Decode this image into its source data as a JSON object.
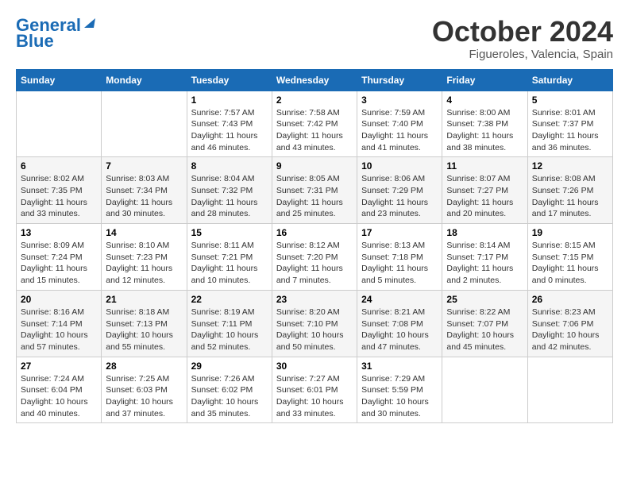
{
  "header": {
    "logo_line1": "General",
    "logo_line2": "Blue",
    "month_title": "October 2024",
    "subtitle": "Figueroles, Valencia, Spain"
  },
  "weekdays": [
    "Sunday",
    "Monday",
    "Tuesday",
    "Wednesday",
    "Thursday",
    "Friday",
    "Saturday"
  ],
  "weeks": [
    [
      {
        "day": "",
        "info": ""
      },
      {
        "day": "",
        "info": ""
      },
      {
        "day": "1",
        "info": "Sunrise: 7:57 AM\nSunset: 7:43 PM\nDaylight: 11 hours and 46 minutes."
      },
      {
        "day": "2",
        "info": "Sunrise: 7:58 AM\nSunset: 7:42 PM\nDaylight: 11 hours and 43 minutes."
      },
      {
        "day": "3",
        "info": "Sunrise: 7:59 AM\nSunset: 7:40 PM\nDaylight: 11 hours and 41 minutes."
      },
      {
        "day": "4",
        "info": "Sunrise: 8:00 AM\nSunset: 7:38 PM\nDaylight: 11 hours and 38 minutes."
      },
      {
        "day": "5",
        "info": "Sunrise: 8:01 AM\nSunset: 7:37 PM\nDaylight: 11 hours and 36 minutes."
      }
    ],
    [
      {
        "day": "6",
        "info": "Sunrise: 8:02 AM\nSunset: 7:35 PM\nDaylight: 11 hours and 33 minutes."
      },
      {
        "day": "7",
        "info": "Sunrise: 8:03 AM\nSunset: 7:34 PM\nDaylight: 11 hours and 30 minutes."
      },
      {
        "day": "8",
        "info": "Sunrise: 8:04 AM\nSunset: 7:32 PM\nDaylight: 11 hours and 28 minutes."
      },
      {
        "day": "9",
        "info": "Sunrise: 8:05 AM\nSunset: 7:31 PM\nDaylight: 11 hours and 25 minutes."
      },
      {
        "day": "10",
        "info": "Sunrise: 8:06 AM\nSunset: 7:29 PM\nDaylight: 11 hours and 23 minutes."
      },
      {
        "day": "11",
        "info": "Sunrise: 8:07 AM\nSunset: 7:27 PM\nDaylight: 11 hours and 20 minutes."
      },
      {
        "day": "12",
        "info": "Sunrise: 8:08 AM\nSunset: 7:26 PM\nDaylight: 11 hours and 17 minutes."
      }
    ],
    [
      {
        "day": "13",
        "info": "Sunrise: 8:09 AM\nSunset: 7:24 PM\nDaylight: 11 hours and 15 minutes."
      },
      {
        "day": "14",
        "info": "Sunrise: 8:10 AM\nSunset: 7:23 PM\nDaylight: 11 hours and 12 minutes."
      },
      {
        "day": "15",
        "info": "Sunrise: 8:11 AM\nSunset: 7:21 PM\nDaylight: 11 hours and 10 minutes."
      },
      {
        "day": "16",
        "info": "Sunrise: 8:12 AM\nSunset: 7:20 PM\nDaylight: 11 hours and 7 minutes."
      },
      {
        "day": "17",
        "info": "Sunrise: 8:13 AM\nSunset: 7:18 PM\nDaylight: 11 hours and 5 minutes."
      },
      {
        "day": "18",
        "info": "Sunrise: 8:14 AM\nSunset: 7:17 PM\nDaylight: 11 hours and 2 minutes."
      },
      {
        "day": "19",
        "info": "Sunrise: 8:15 AM\nSunset: 7:15 PM\nDaylight: 11 hours and 0 minutes."
      }
    ],
    [
      {
        "day": "20",
        "info": "Sunrise: 8:16 AM\nSunset: 7:14 PM\nDaylight: 10 hours and 57 minutes."
      },
      {
        "day": "21",
        "info": "Sunrise: 8:18 AM\nSunset: 7:13 PM\nDaylight: 10 hours and 55 minutes."
      },
      {
        "day": "22",
        "info": "Sunrise: 8:19 AM\nSunset: 7:11 PM\nDaylight: 10 hours and 52 minutes."
      },
      {
        "day": "23",
        "info": "Sunrise: 8:20 AM\nSunset: 7:10 PM\nDaylight: 10 hours and 50 minutes."
      },
      {
        "day": "24",
        "info": "Sunrise: 8:21 AM\nSunset: 7:08 PM\nDaylight: 10 hours and 47 minutes."
      },
      {
        "day": "25",
        "info": "Sunrise: 8:22 AM\nSunset: 7:07 PM\nDaylight: 10 hours and 45 minutes."
      },
      {
        "day": "26",
        "info": "Sunrise: 8:23 AM\nSunset: 7:06 PM\nDaylight: 10 hours and 42 minutes."
      }
    ],
    [
      {
        "day": "27",
        "info": "Sunrise: 7:24 AM\nSunset: 6:04 PM\nDaylight: 10 hours and 40 minutes."
      },
      {
        "day": "28",
        "info": "Sunrise: 7:25 AM\nSunset: 6:03 PM\nDaylight: 10 hours and 37 minutes."
      },
      {
        "day": "29",
        "info": "Sunrise: 7:26 AM\nSunset: 6:02 PM\nDaylight: 10 hours and 35 minutes."
      },
      {
        "day": "30",
        "info": "Sunrise: 7:27 AM\nSunset: 6:01 PM\nDaylight: 10 hours and 33 minutes."
      },
      {
        "day": "31",
        "info": "Sunrise: 7:29 AM\nSunset: 5:59 PM\nDaylight: 10 hours and 30 minutes."
      },
      {
        "day": "",
        "info": ""
      },
      {
        "day": "",
        "info": ""
      }
    ]
  ]
}
